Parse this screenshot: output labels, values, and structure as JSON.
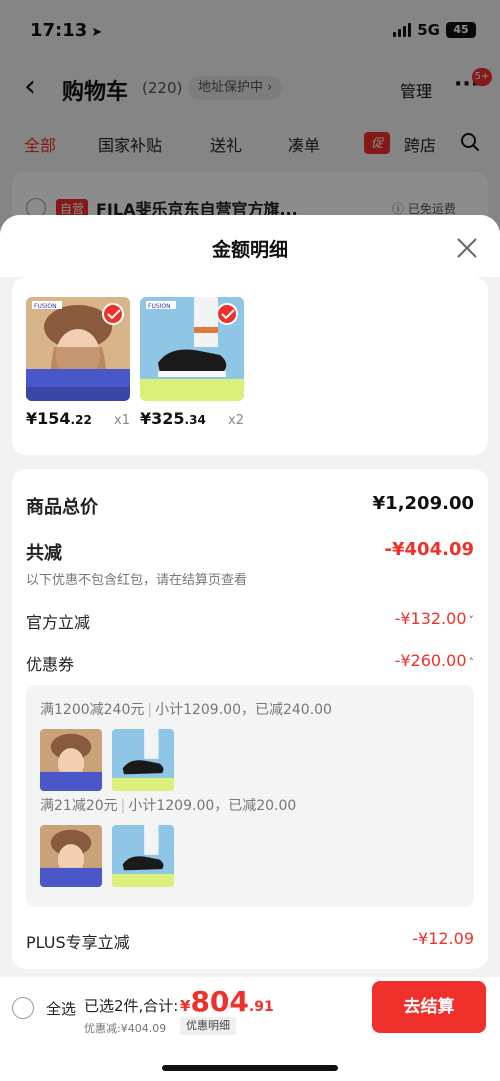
{
  "status_bar": {
    "time": "17:13",
    "network": "5G",
    "battery": "45"
  },
  "cart": {
    "title": "购物车",
    "count": "(220)",
    "address_protection": "地址保护中 ›",
    "manage_label": "管理",
    "message_badge": "5+",
    "tabs": [
      "全部",
      "国家补贴",
      "送礼",
      "凑单",
      "跨店"
    ],
    "promo_tag": "促",
    "shop": {
      "tag": "自营",
      "name": "FILA斐乐京东自营官方旗...",
      "shipping": "ⓘ 已免运费"
    }
  },
  "sheet": {
    "title": "金额明细",
    "items": [
      {
        "price_int": "¥154",
        "price_dec": ".22",
        "qty": "x1",
        "thumb": "girl-hat"
      },
      {
        "price_int": "¥325",
        "price_dec": ".34",
        "qty": "x2",
        "thumb": "sneaker"
      }
    ],
    "total_label": "商品总价",
    "total_value": "¥1,209.00",
    "reduce_label": "共减",
    "reduce_value": "-¥404.09",
    "reduce_note": "以下优惠不包含红包，请在结算页查看",
    "official_label": "官方立减",
    "official_value": "-¥132.00",
    "coupon_label": "优惠券",
    "coupon_value": "-¥260.00",
    "coupons": [
      {
        "rule": "满1200减240元",
        "detail": "小计1209.00，已减240.00"
      },
      {
        "rule": "满21减20元",
        "detail": "小计1209.00，已减20.00"
      }
    ],
    "plus_label": "PLUS专享立减",
    "plus_value": "-¥12.09"
  },
  "bottom_bar": {
    "select_all": "全选",
    "selected": "已选2件,合计:",
    "amount_currency": "¥",
    "amount_int": "804",
    "amount_dec": ".91",
    "discount_note": "优惠减:¥404.09",
    "detail_label": "优惠明细",
    "checkout_label": "去结算"
  },
  "colors": {
    "accent": "#f0302a",
    "sheet_bg": "#f2f2f2"
  }
}
